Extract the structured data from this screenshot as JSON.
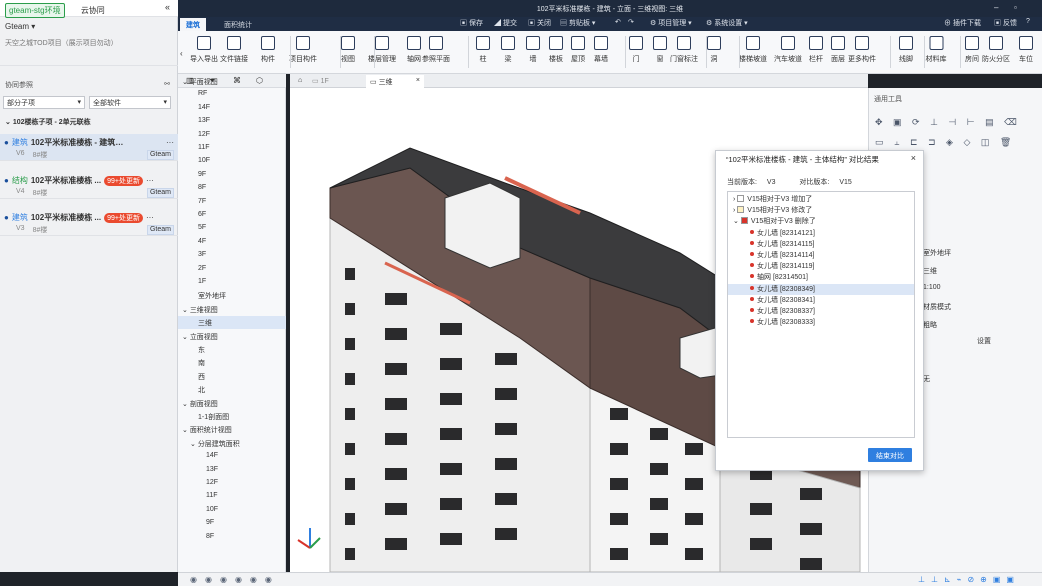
{
  "left": {
    "env_tag": "gteam-stg环境",
    "app_name": "云协同",
    "team": "Gteam",
    "project": "天空之城TOD项目（展示项目勿动）",
    "section": "协同参照",
    "filter1": "部分子项",
    "filter2": "全部软件",
    "group": "102楼栋子项 - 2单元联栋",
    "items": [
      {
        "tag": "建筑",
        "name": "102平米标准楼栋 - 建筑 - 出图",
        "ver": "V6",
        "bldg": "8#楼",
        "badge": "",
        "owner": "Gteam"
      },
      {
        "tag": "结构",
        "name": "102平米标准楼栋 ...",
        "ver": "V4",
        "bldg": "8#楼",
        "badge": "99+处更新",
        "owner": "Gteam"
      },
      {
        "tag": "建筑",
        "name": "102平米标准楼栋 ...",
        "ver": "V3",
        "bldg": "8#楼",
        "badge": "99+处更新",
        "owner": "Gteam"
      }
    ]
  },
  "title": "102平米标准楼栋 - 建筑 - 立面 - 三维视图: 三维",
  "titlebar_actions": {
    "save": "保存",
    "submit": "提交",
    "close": "关闭",
    "clipboard": "剪贴板",
    "pm": "项目管理",
    "settings": "系统设置",
    "plugin": "插件下载",
    "feedback": "反馈"
  },
  "ribbon_tabs": [
    "建筑",
    "面积统计"
  ],
  "tools": [
    {
      "label": "导入导出"
    },
    {
      "label": "文件链接"
    },
    {
      "label": "构件"
    },
    {
      "label": "项目构件"
    },
    {
      "label": "视图"
    },
    {
      "label": "楼层管理"
    },
    {
      "label": "轴网"
    },
    {
      "label": "参照平面"
    },
    {
      "label": "柱"
    },
    {
      "label": "梁"
    },
    {
      "label": "墙"
    },
    {
      "label": "楼板"
    },
    {
      "label": "屋顶"
    },
    {
      "label": "幕墙"
    },
    {
      "label": "门"
    },
    {
      "label": "窗"
    },
    {
      "label": "门窗标注"
    },
    {
      "label": "洞"
    },
    {
      "label": "楼梯坡道"
    },
    {
      "label": "汽车坡道"
    },
    {
      "label": "栏杆"
    },
    {
      "label": "面层"
    },
    {
      "label": "更多构件"
    },
    {
      "label": "线脚"
    },
    {
      "label": "材料库"
    },
    {
      "label": "房间"
    },
    {
      "label": "防火分区"
    },
    {
      "label": "车位"
    }
  ],
  "tree": {
    "plan": "平面视图",
    "floors": [
      "RF",
      "14F",
      "13F",
      "12F",
      "11F",
      "10F",
      "9F",
      "8F",
      "7F",
      "6F",
      "5F",
      "4F",
      "3F",
      "2F",
      "1F",
      "室外地坪"
    ],
    "view3d": "三维视图",
    "view3d_item": "三维",
    "elev": "立面视图",
    "elev_items": [
      "东",
      "南",
      "西",
      "北"
    ],
    "section": "剖面视图",
    "section_item": "1-1剖面图",
    "area": "面积统计视图",
    "area_sub": "分层建筑面积",
    "area_floors": [
      "14F",
      "13F",
      "12F",
      "11F",
      "10F",
      "9F",
      "8F"
    ]
  },
  "view_tabs": [
    "1F",
    "三维"
  ],
  "props": {
    "header": "通用工具",
    "rows": [
      "室外地坪",
      "三维",
      "1:100",
      "材质模式",
      "粗略",
      "设置",
      "无"
    ]
  },
  "dialog": {
    "title": "“102平米标准楼栋 - 建筑 - 主体结构” 对比结果",
    "current_label": "当前版本:",
    "current": "V3",
    "compare_label": "对比版本:",
    "compare": "V15",
    "groups": [
      {
        "label": "V15相对于V3  增加了",
        "color": "#ffffff",
        "expanded": false
      },
      {
        "label": "V15相对于V3  修改了",
        "color": "#fff3c4",
        "expanded": false
      },
      {
        "label": "V15相对于V3  删除了",
        "color": "#d8342b",
        "expanded": true
      }
    ],
    "deleted": [
      "女儿墙 [82314121]",
      "女儿墙 [82314115]",
      "女儿墙 [82314114]",
      "女儿墙 [82314119]",
      "轴网 [82314501]",
      "女儿墙 [82308349]",
      "女儿墙 [82308341]",
      "女儿墙 [82308337]",
      "女儿墙 [82308333]"
    ],
    "button": "结束对比"
  },
  "colors": {
    "accent": "#2f7fe0",
    "deleted": "#d8342b",
    "titlebar": "#1e2a3d"
  }
}
